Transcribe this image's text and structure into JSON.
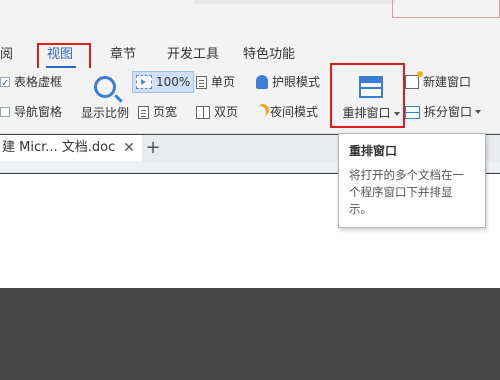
{
  "tabs": {
    "partial": "阅",
    "view": "视图",
    "chapter": "章节",
    "developer": "开发工具",
    "features": "特色功能"
  },
  "ribbon": {
    "table_grid": "表格虚框",
    "nav_pane": "导航窗格",
    "zoom_ratio": "显示比例",
    "zoom_100": "100%",
    "single_page": "单页",
    "page_width": "页宽",
    "double_page": "双页",
    "eye_mode": "护眼模式",
    "night_mode": "夜间模式",
    "arrange_window": "重排窗口",
    "new_window": "新建窗口",
    "split_window": "拆分窗口"
  },
  "doc_tabs": {
    "active_tab": "建 Micr... 文档.doc",
    "close_symbol": "✕",
    "add_symbol": "+"
  },
  "tooltip": {
    "title": "重排窗口",
    "body": "将打开的多个文档在一个程序窗口下并排显示。"
  },
  "colors": {
    "accent": "#2a66c2",
    "highlight_box": "#e21b1b",
    "dark_background": "#464646"
  }
}
